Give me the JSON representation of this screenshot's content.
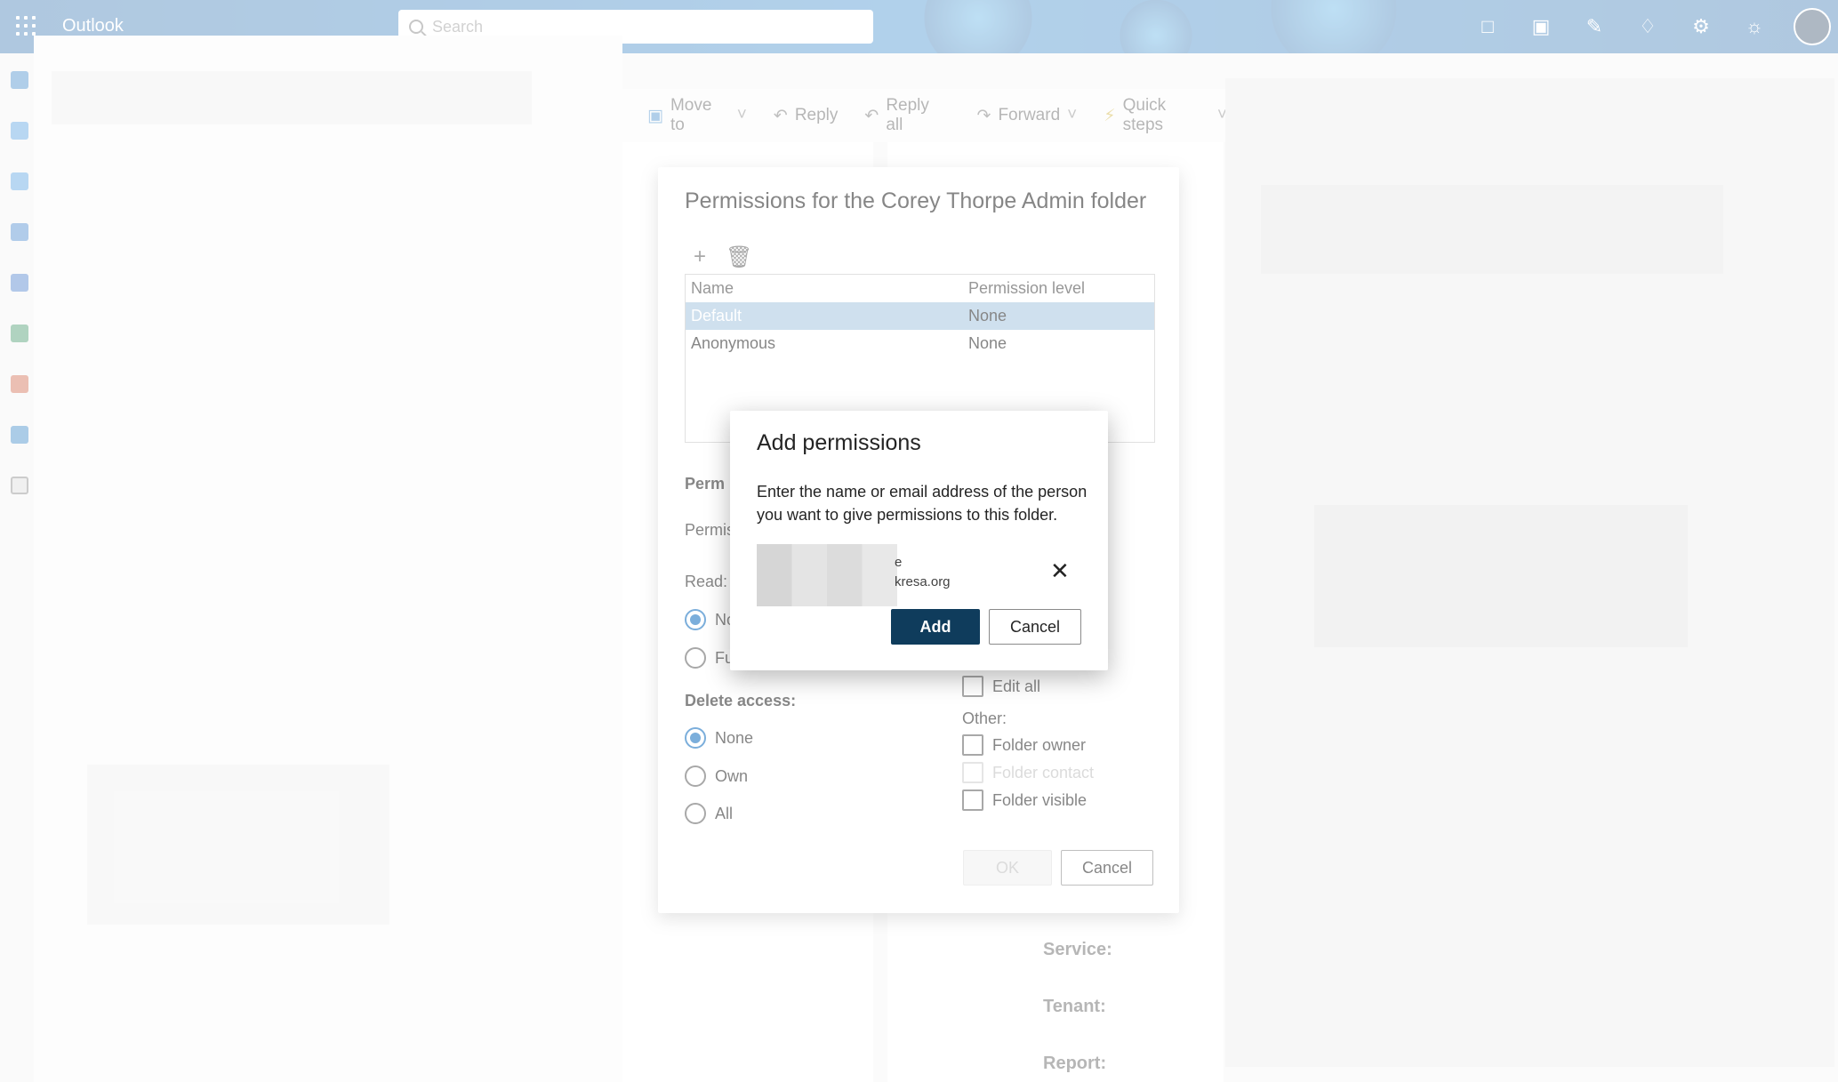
{
  "app": {
    "name": "Outlook"
  },
  "search": {
    "placeholder": "Search"
  },
  "toolbar": {
    "move_to": "Move to",
    "reply": "Reply",
    "reply_all": "Reply all",
    "forward": "Forward",
    "quick_steps": "Quick steps"
  },
  "reading": {
    "service_label": "Service:",
    "tenant_label": "Tenant:",
    "report_label": "Report:"
  },
  "permissions_dialog": {
    "title": "Permissions for the Corey Thorpe Admin folder",
    "table": {
      "col_name": "Name",
      "col_level": "Permission level",
      "rows": [
        {
          "name": "Default",
          "level": "None"
        },
        {
          "name": "Anonymous",
          "level": "None"
        }
      ]
    },
    "section_partial": "Perm",
    "permission_partial": "Permis",
    "read_label": "Read:",
    "read_opt1": "No",
    "read_opt2": "Fu",
    "delete_label": "Delete access:",
    "delete_options": [
      "None",
      "Own",
      "All"
    ],
    "edit_all": "Edit all",
    "other_label": "Other:",
    "folder_owner": "Folder owner",
    "folder_contact": "Folder contact",
    "folder_visible": "Folder visible",
    "ok": "OK",
    "cancel": "Cancel"
  },
  "add_dialog": {
    "title": "Add permissions",
    "description": "Enter the name or email address of the person you want to give permissions to this folder.",
    "persona_name_partial": "e",
    "persona_email_partial": "kresa.org",
    "add": "Add",
    "cancel": "Cancel"
  },
  "colors": {
    "accent": "#0f6cbd",
    "primary_button": "#0f3c5c",
    "selected_row": "#a8c6e0"
  }
}
